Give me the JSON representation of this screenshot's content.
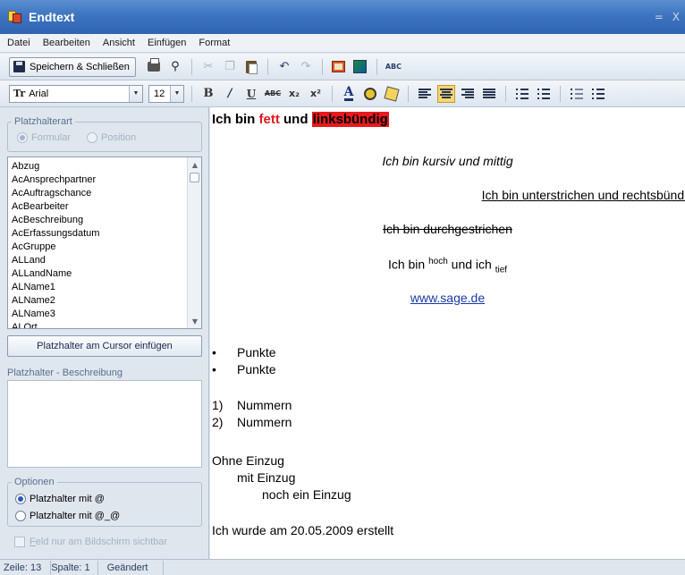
{
  "window": {
    "title": "Endtext",
    "ctrl_min": "=",
    "ctrl_close": "X"
  },
  "menu": [
    "Datei",
    "Bearbeiten",
    "Ansicht",
    "Einfügen",
    "Format"
  ],
  "toolbar": {
    "save_label": "Speichern & Schließen",
    "spell_label": "ABC"
  },
  "format_toolbar": {
    "font": "Arial",
    "size": "12",
    "strike_label": "ABC"
  },
  "left": {
    "placeholder_type": {
      "legend": "Platzhalterart",
      "opt_formular": "Formular",
      "opt_position": "Position",
      "selected": "Formular"
    },
    "placeholders": [
      "Abzug",
      "AcAnsprechpartner",
      "AcAuftragschance",
      "AcBearbeiter",
      "AcBeschreibung",
      "AcErfassungsdatum",
      "AcGruppe",
      "ALLand",
      "ALLandName",
      "ALName1",
      "ALName2",
      "ALName3",
      "ALOrt"
    ],
    "insert_button": "Platzhalter am Cursor einfügen",
    "description_label": "Platzhalter - Beschreibung",
    "options": {
      "legend": "Optionen",
      "opt1": "Platzhalter mit @",
      "opt2": "Platzhalter mit @_@",
      "selected": "Platzhalter mit @"
    },
    "checkbox_label": "Feld nur am Bildschirm sichtbar"
  },
  "document": {
    "line1_a": "Ich bin ",
    "line1_b": "fett",
    "line1_c": " und ",
    "line1_d": "linksbündig",
    "line2": "Ich bin kursiv und mittig",
    "line3": "Ich bin unterstrichen und rechtsbündig",
    "line4": "Ich bin durchgestrichen",
    "line5_a": "Ich bin ",
    "line5_b": "hoch",
    "line5_c": " und ich ",
    "line5_d": "tief",
    "link": "www.sage.de",
    "bullets": [
      "Punkte",
      "Punkte"
    ],
    "numbers": [
      "Nummern",
      "Nummern"
    ],
    "number_markers": [
      "1)",
      "2)"
    ],
    "indent0": "Ohne Einzug",
    "indent1": "mit Einzug",
    "indent2": "noch ein Einzug",
    "created": "Ich wurde am 20.05.2009 erstellt"
  },
  "status": {
    "line": "Zeile: 13",
    "column": "Spalte: 1",
    "state": "Geändert"
  },
  "colors": {
    "title_bar": "#3d74bf",
    "highlight": "#e8191c",
    "bold_red": "#e1191c",
    "link": "#1a3aa8"
  }
}
